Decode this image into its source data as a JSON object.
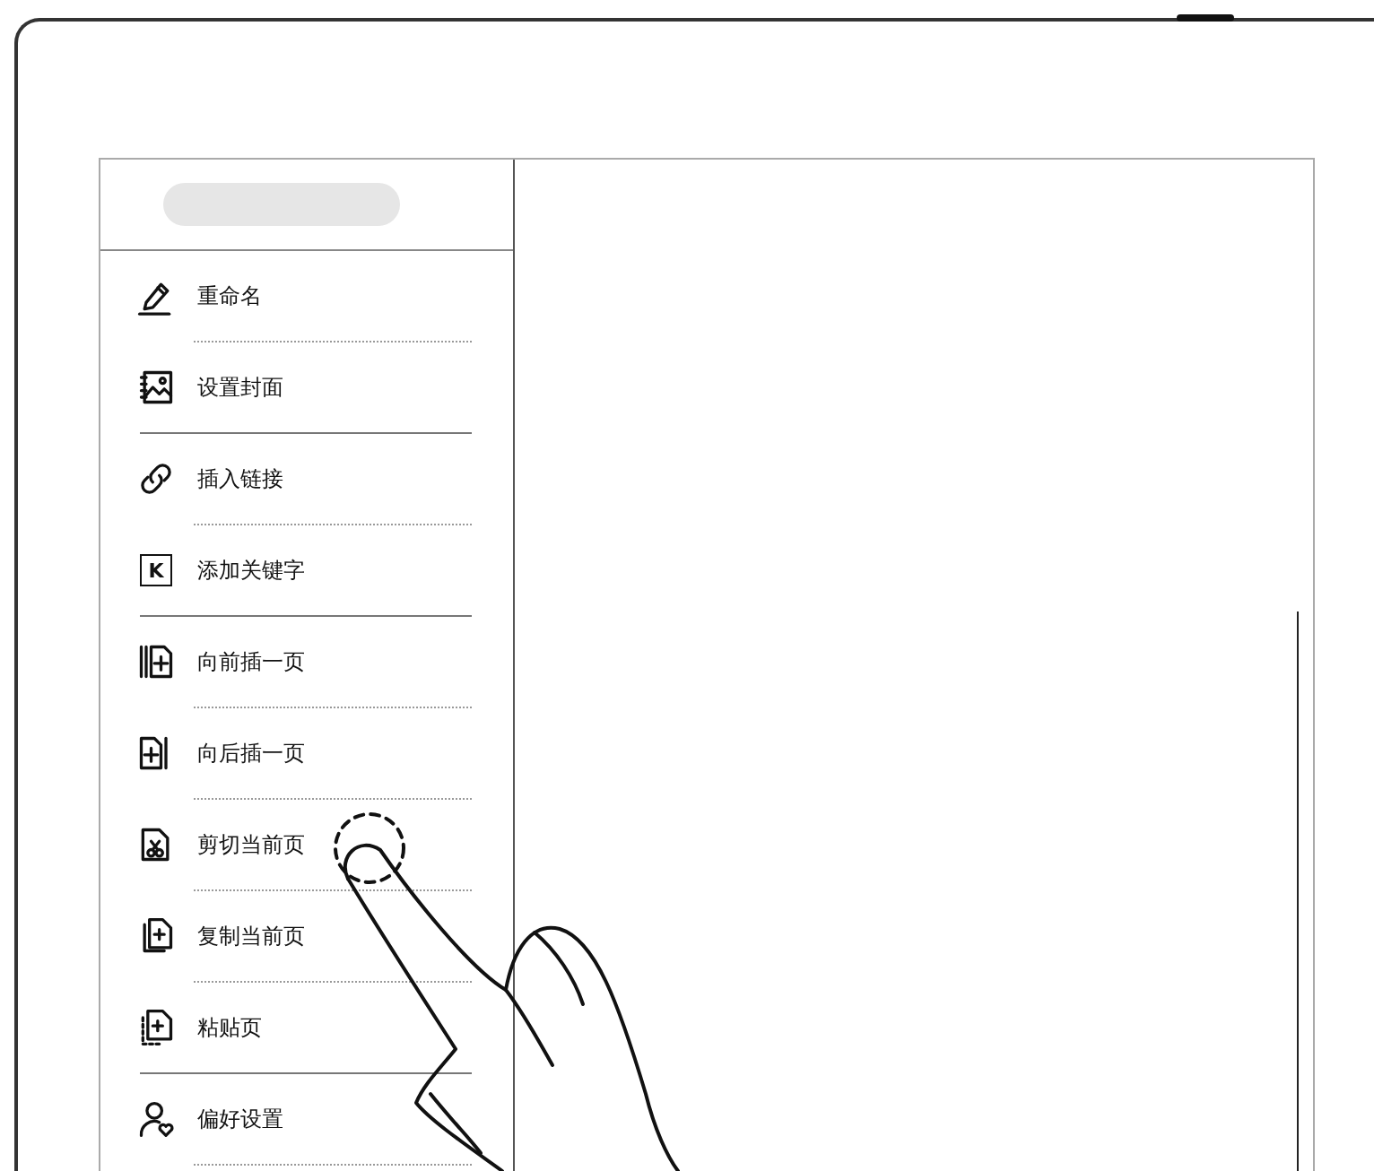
{
  "menu": {
    "groups": [
      {
        "items": [
          {
            "label": "重命名"
          },
          {
            "label": "设置封面"
          }
        ]
      },
      {
        "items": [
          {
            "label": "插入链接"
          },
          {
            "label": "添加关键字",
            "icon_letter": "K"
          }
        ]
      },
      {
        "items": [
          {
            "label": "向前插一页"
          },
          {
            "label": "向后插一页"
          },
          {
            "label": "剪切当前页"
          },
          {
            "label": "复制当前页"
          },
          {
            "label": "粘贴页"
          }
        ]
      },
      {
        "items": [
          {
            "label": "偏好设置"
          }
        ]
      }
    ]
  }
}
